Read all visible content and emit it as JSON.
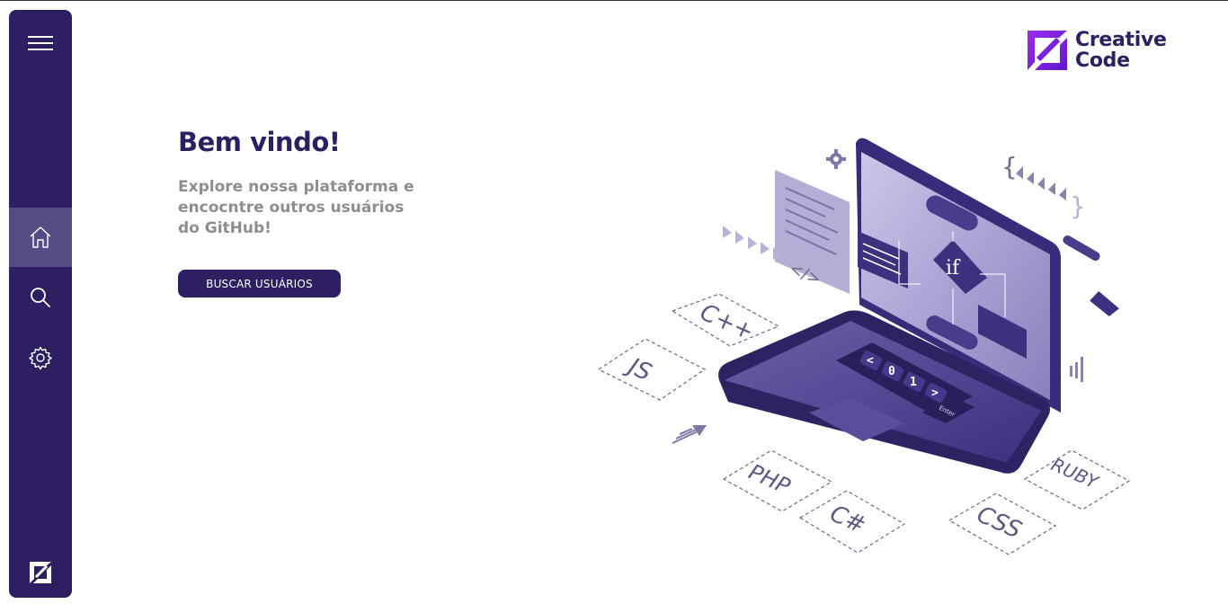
{
  "sidebar": {
    "items": [
      {
        "icon": "menu-icon"
      },
      {
        "icon": "home-icon",
        "active": true
      },
      {
        "icon": "search-icon"
      },
      {
        "icon": "gear-icon"
      }
    ],
    "footer_logo": "creative-code-logo-mark"
  },
  "brand": {
    "line1": "Creative",
    "line2": "Code"
  },
  "hero": {
    "title": "Bem vindo!",
    "subtitle": "Explore nossa plataforma e encocntre outros usuários do GitHub!",
    "cta_label": "BUSCAR USUÁRIOS"
  },
  "illustration": {
    "tags": [
      "C++",
      "JS",
      "PHP",
      "C#",
      "CSS",
      "RUBY"
    ],
    "keys": [
      "<",
      "0",
      "1",
      ">"
    ],
    "enter_label": "Enter",
    "flow_label": "if",
    "code_symbol": "</>"
  },
  "colors": {
    "primary": "#2e1f63",
    "sidebar_active": "#574b86",
    "muted_text": "#8e8e8e",
    "accent_purple": "#7b2ff7"
  }
}
